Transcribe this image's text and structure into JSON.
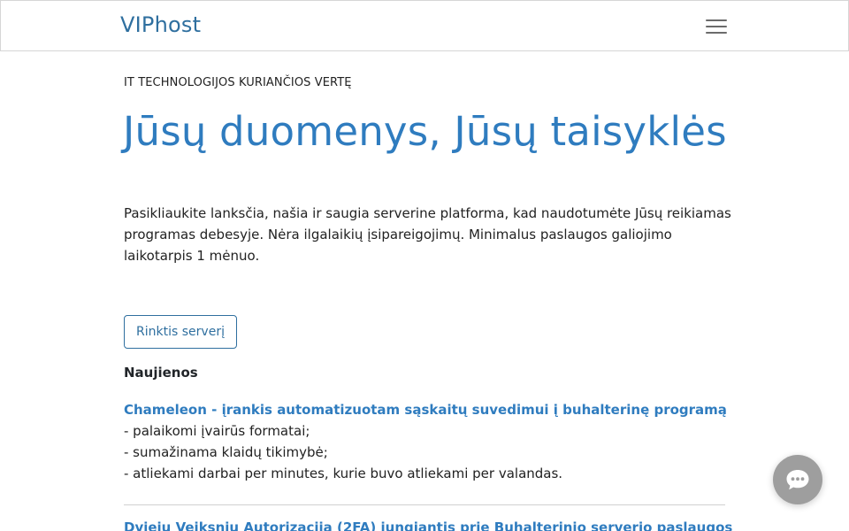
{
  "header": {
    "brand": "VIPhost",
    "menu_icon": "hamburger-menu-icon"
  },
  "hero": {
    "eyebrow": "IT TECHNOLOGIJOS KURIANČIOS VERTĘ",
    "title": "Jūsų duomenys, Jūsų taisyklės",
    "lead": "Pasikliaukite lanksčia, našia ir saugia serverine platforma, kad naudotumėte Jūsų reikiamas programas debesyje. Nėra ilgalaikių įsipareigojimų. Minimalus paslaugos galiojimo laikotarpis 1 mėnuo.",
    "cta_label": "Rinktis serverį"
  },
  "news": {
    "heading": "Naujienos",
    "items": [
      {
        "title": "Chameleon - įrankis automatizuotam sąskaitų suvedimui į buhalterinę programą",
        "lines": [
          "- palaikomi įvairūs formatai;",
          "- sumažinama klaidų tikimybė;",
          "- atliekami darbai per minutes, kurie buvo atliekami per valandas."
        ]
      },
      {
        "title": "Dviejų Veiksnių Autorizacija (2FA) jungiantis prie Buhalterinio serverio paslaugos"
      }
    ]
  },
  "chat": {
    "icon": "chat-bubble-icon"
  },
  "colors": {
    "brand": "#2f6f9f",
    "accent": "#2f7cbf",
    "chat_button": "#9e9e9e"
  }
}
